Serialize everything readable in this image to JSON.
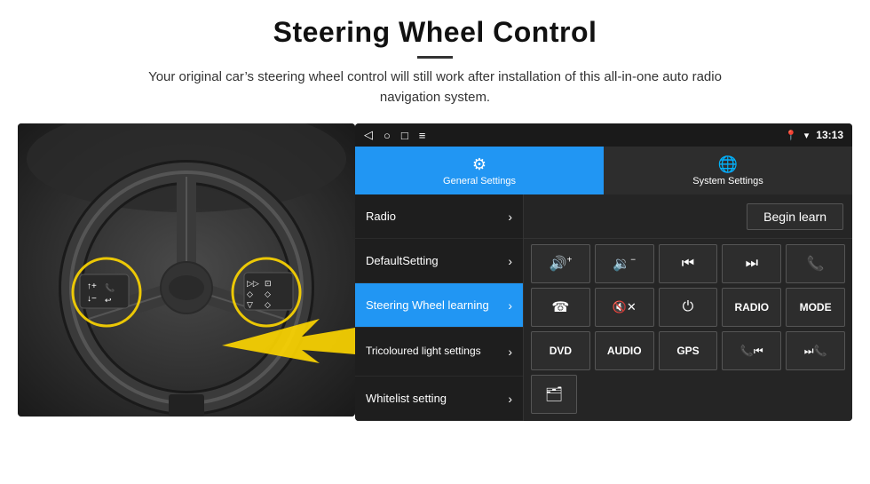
{
  "header": {
    "title": "Steering Wheel Control",
    "subtitle": "Your original car’s steering wheel control will still work after installation of this all-in-one auto radio navigation system."
  },
  "status_bar": {
    "time": "13:13",
    "icons_left": [
      "back",
      "home",
      "square",
      "menu"
    ],
    "icons_right": [
      "location",
      "wifi",
      "signal"
    ]
  },
  "tabs": [
    {
      "id": "general",
      "label": "General Settings",
      "active": true
    },
    {
      "id": "system",
      "label": "System Settings",
      "active": false
    }
  ],
  "menu_items": [
    {
      "id": "radio",
      "label": "Radio",
      "active": false
    },
    {
      "id": "default",
      "label": "DefaultSetting",
      "active": false
    },
    {
      "id": "steering",
      "label": "Steering Wheel learning",
      "active": true
    },
    {
      "id": "tricoloured",
      "label": "Tricoloured light settings",
      "active": false
    },
    {
      "id": "whitelist",
      "label": "Whitelist setting",
      "active": false
    }
  ],
  "panel": {
    "begin_learn_label": "Begin learn",
    "control_rows": [
      [
        {
          "type": "icon",
          "symbol": "🔊+"
        },
        {
          "type": "icon",
          "symbol": "🔉−"
        },
        {
          "type": "icon",
          "symbol": "⏮"
        },
        {
          "type": "icon",
          "symbol": "⏭"
        },
        {
          "type": "icon",
          "symbol": "📞"
        }
      ],
      [
        {
          "type": "icon",
          "symbol": "☎"
        },
        {
          "type": "icon",
          "symbol": "🔇×"
        },
        {
          "type": "icon",
          "symbol": "⏻"
        },
        {
          "type": "text",
          "symbol": "RADIO"
        },
        {
          "type": "text",
          "symbol": "MODE"
        }
      ],
      [
        {
          "type": "text",
          "symbol": "DVD"
        },
        {
          "type": "text",
          "symbol": "AUDIO"
        },
        {
          "type": "text",
          "symbol": "GPS"
        },
        {
          "type": "icon",
          "symbol": "📞⏮"
        },
        {
          "type": "icon",
          "symbol": "⏭☎"
        }
      ],
      [
        {
          "type": "icon",
          "symbol": "🗂"
        }
      ]
    ]
  },
  "colors": {
    "accent_blue": "#2196F3",
    "dark_bg": "#1a1a1a",
    "panel_bg": "#252525",
    "button_bg": "#2d2d2d"
  }
}
